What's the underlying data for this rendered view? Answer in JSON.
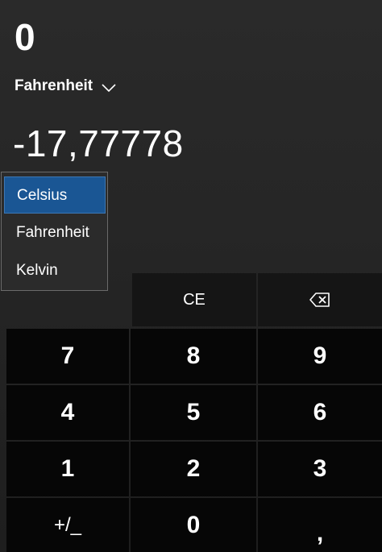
{
  "display": {
    "input_value": "0",
    "from_unit": "Fahrenheit",
    "output_value": "-17,77778"
  },
  "dropdown": {
    "options": [
      "Celsius",
      "Fahrenheit",
      "Kelvin"
    ],
    "selected": "Celsius"
  },
  "keypad": {
    "ce": "CE",
    "backspace_icon": "backspace-icon",
    "rows": [
      [
        "7",
        "8",
        "9"
      ],
      [
        "4",
        "5",
        "6"
      ],
      [
        "1",
        "2",
        "3"
      ],
      [
        "+/_",
        "0",
        ","
      ]
    ]
  }
}
